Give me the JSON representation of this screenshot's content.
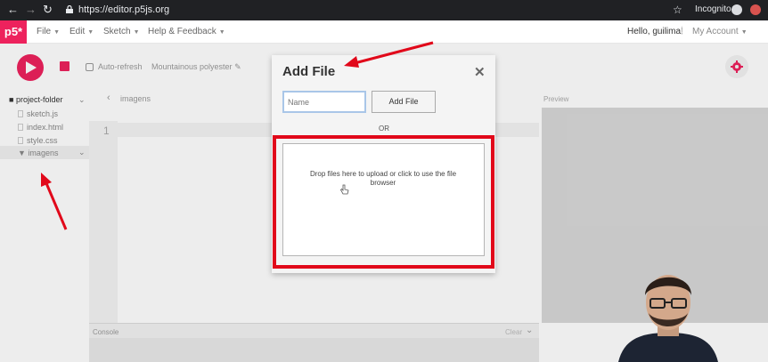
{
  "browser": {
    "url": "https://editor.p5js.org",
    "incognito_label": "Incognito"
  },
  "app": {
    "logo": "p5*",
    "menus": [
      "File",
      "Edit",
      "Sketch",
      "Help & Feedback"
    ],
    "greeting": "Hello, guilima!",
    "account_menu": "My Account"
  },
  "toolbar": {
    "auto_refresh_label": "Auto-refresh",
    "sketch_name": "Mountainous polyester"
  },
  "sidebar": {
    "folder": "project-folder",
    "files": [
      "sketch.js",
      "index.html",
      "style.css"
    ],
    "subfolder": "imagens"
  },
  "editor": {
    "tab_title": "imagens",
    "line_number": "1",
    "console_label": "Console",
    "console_clear": "Clear"
  },
  "preview": {
    "label": "Preview"
  },
  "modal": {
    "title": "Add File",
    "name_placeholder": "Name",
    "add_button": "Add File",
    "or_label": "OR",
    "drop_text": "Drop files here to upload or click to use the file browser"
  },
  "colors": {
    "accent": "#ed225d",
    "annotation_red": "#e1081a"
  }
}
